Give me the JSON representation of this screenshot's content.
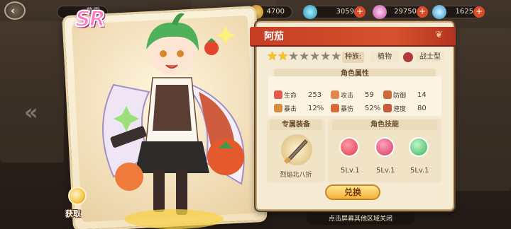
{
  "top_bar": {
    "resources": [
      {
        "icon": "stamina-icon",
        "value": "暮雪"
      },
      {
        "icon": "coin-icon",
        "value": "4700"
      },
      {
        "icon": "ticket-icon",
        "value": "3059"
      },
      {
        "icon": "gem-icon",
        "value": "29750"
      },
      {
        "icon": "crystal-icon",
        "value": "1625"
      }
    ]
  },
  "card": {
    "rarity": "SR",
    "obtain_label": "获取"
  },
  "hero": {
    "name": "阿茄",
    "stars_total": 7,
    "stars_filled": 2,
    "race_label": "种族:",
    "race_value": "植物",
    "type_value": "战士型"
  },
  "attributes": {
    "section_title": "角色属性",
    "items": [
      {
        "icon": "heart-icon",
        "name": "生命",
        "value": "253",
        "color": "#e0594e"
      },
      {
        "icon": "sword-icon",
        "name": "攻击",
        "value": "59",
        "color": "#e0894e"
      },
      {
        "icon": "shield-icon",
        "name": "防御",
        "value": "14",
        "color": "#c96a3a"
      },
      {
        "icon": "crit-icon",
        "name": "暴击",
        "value": "12%",
        "color": "#d88b3a"
      },
      {
        "icon": "crit-damage-icon",
        "name": "暴伤",
        "value": "52%",
        "color": "#d86a3a"
      },
      {
        "icon": "speed-icon",
        "name": "速度",
        "value": "80",
        "color": "#c85a3a"
      }
    ]
  },
  "equipment": {
    "section_title": "专属装备",
    "item_name": "烈焰北八折"
  },
  "skills": {
    "section_title": "角色技能",
    "items": [
      {
        "icon": "skill-slash-icon",
        "level": "5Lv.1",
        "color": "#e23a4a"
      },
      {
        "icon": "skill-gift-icon",
        "level": "5Lv.1",
        "color": "#d63a5e"
      },
      {
        "icon": "skill-heal-icon",
        "level": "5Lv.1",
        "color": "#3ab25a"
      }
    ]
  },
  "actions": {
    "swap_label": "兑换"
  },
  "footer": {
    "hint": "点击屏幕其他区域关闭"
  }
}
